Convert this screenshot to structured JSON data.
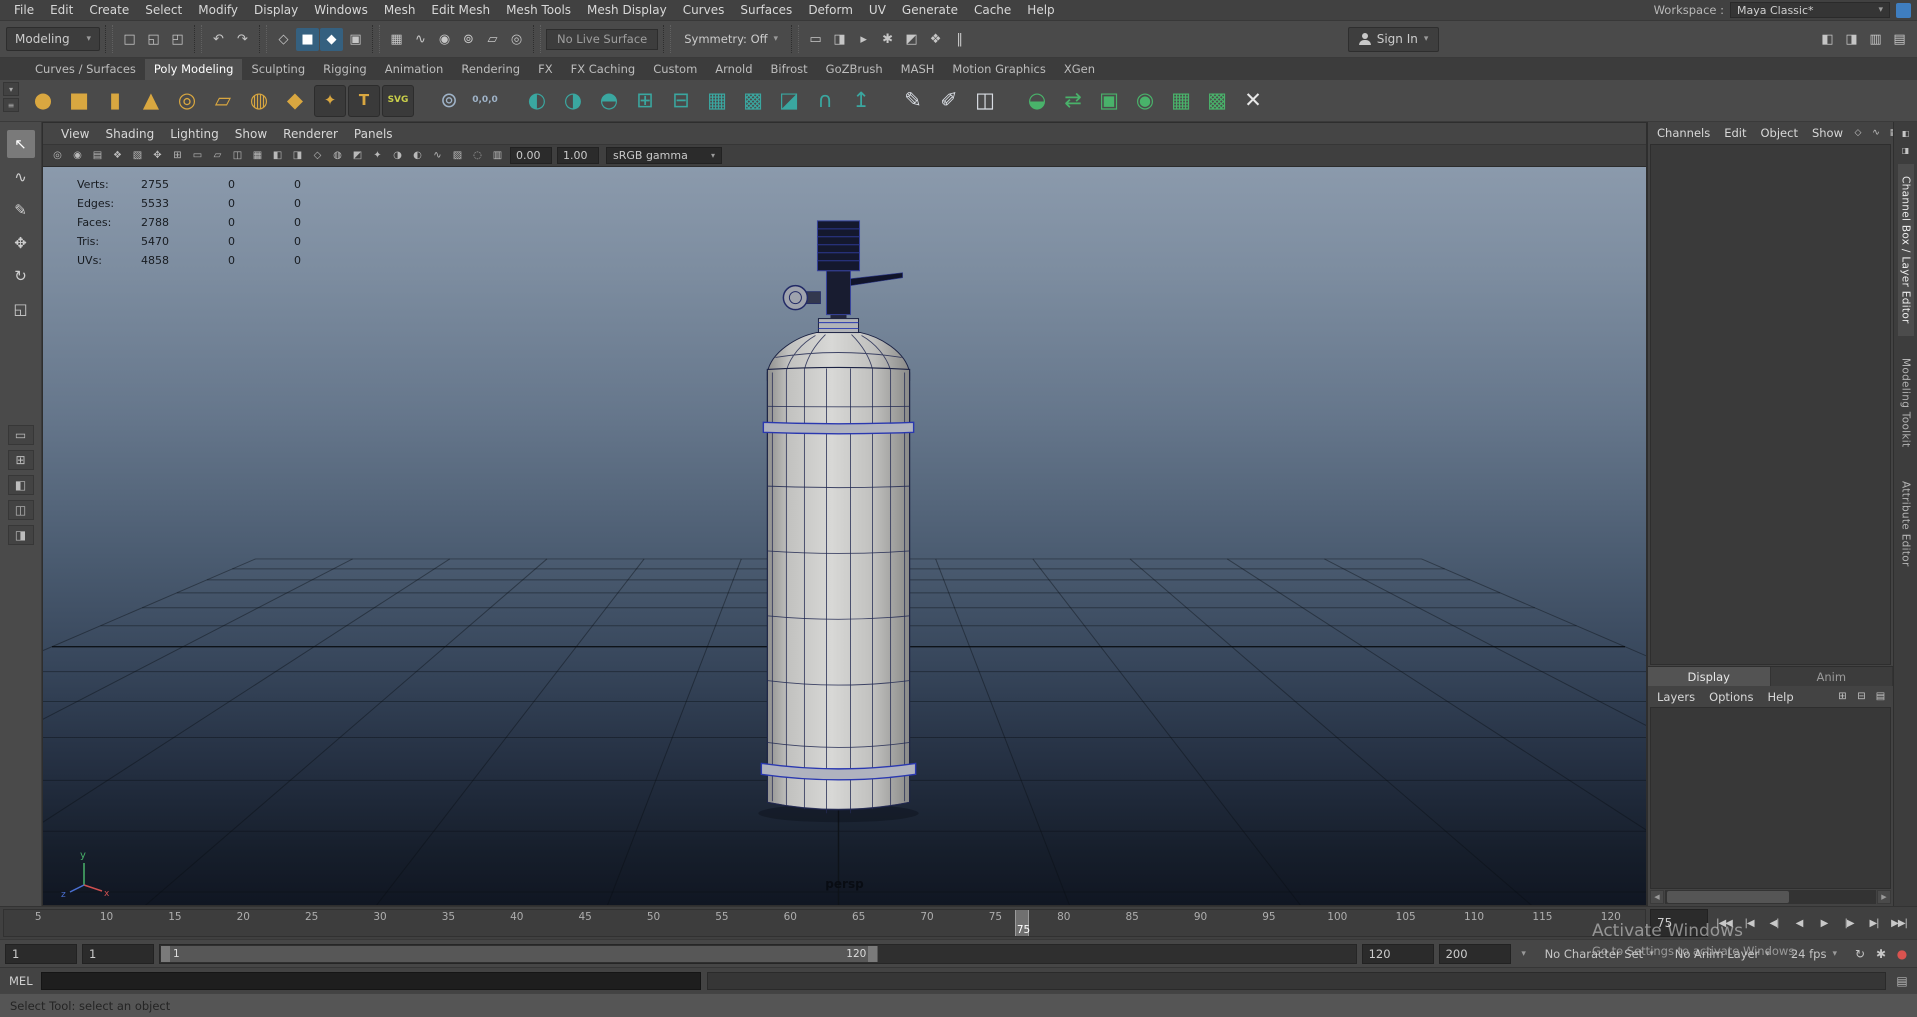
{
  "colors": {
    "accent": "#35607f",
    "workspace_icon_blue": "#3f7ec0",
    "shelf_gold": "#d9a740",
    "shelf_teal": "#3aa7a0",
    "shelf_green": "#49b26a",
    "wireframe_navy": "#232a52",
    "selection_ring_blue": "#2a38b0",
    "autokey_red": "#d9534f"
  },
  "ui": {
    "caret": "▾",
    "shelf_toggle": "▾",
    "shelf_menu": "≡",
    "scroll_left": "◀",
    "scroll_right": "▶"
  },
  "menubar": {
    "items": [
      {
        "name": "menu-file",
        "label": "File"
      },
      {
        "name": "menu-edit",
        "label": "Edit"
      },
      {
        "name": "menu-create",
        "label": "Create"
      },
      {
        "name": "menu-select",
        "label": "Select"
      },
      {
        "name": "menu-modify",
        "label": "Modify"
      },
      {
        "name": "menu-display",
        "label": "Display"
      },
      {
        "name": "menu-windows",
        "label": "Windows"
      },
      {
        "name": "menu-mesh",
        "label": "Mesh"
      },
      {
        "name": "menu-edit-mesh",
        "label": "Edit Mesh"
      },
      {
        "name": "menu-mesh-tools",
        "label": "Mesh Tools"
      },
      {
        "name": "menu-mesh-display",
        "label": "Mesh Display"
      },
      {
        "name": "menu-curves",
        "label": "Curves"
      },
      {
        "name": "menu-surfaces",
        "label": "Surfaces"
      },
      {
        "name": "menu-deform",
        "label": "Deform"
      },
      {
        "name": "menu-uv",
        "label": "UV"
      },
      {
        "name": "menu-generate",
        "label": "Generate"
      },
      {
        "name": "menu-cache",
        "label": "Cache"
      },
      {
        "name": "menu-help",
        "label": "Help"
      }
    ],
    "workspace_label": "Workspace :",
    "workspace_value": "Maya Classic*"
  },
  "statusline": {
    "menuset": "Modeling",
    "file_icons": [
      {
        "name": "new-scene-icon",
        "glyph": "□"
      },
      {
        "name": "open-scene-icon",
        "glyph": "◱"
      },
      {
        "name": "save-scene-icon",
        "glyph": "◰"
      }
    ],
    "history_icons": [
      {
        "name": "undo-icon",
        "glyph": "↶"
      },
      {
        "name": "redo-icon",
        "glyph": "↷"
      }
    ],
    "mask_icons": [
      {
        "name": "select-hierarchy-icon",
        "glyph": "◇"
      },
      {
        "name": "select-object-icon",
        "glyph": "■",
        "active": true
      },
      {
        "name": "select-component-icon",
        "glyph": "◆",
        "active": true
      },
      {
        "name": "selection-mask-icon",
        "glyph": "▣"
      }
    ],
    "snap_icons": [
      {
        "name": "snap-to-grid-icon",
        "glyph": "▦"
      },
      {
        "name": "snap-to-curve-icon",
        "glyph": "∿"
      },
      {
        "name": "snap-to-point-icon",
        "glyph": "◉"
      },
      {
        "name": "snap-to-projected-center-icon",
        "glyph": "⊚"
      },
      {
        "name": "snap-to-view-plane-icon",
        "glyph": "▱"
      },
      {
        "name": "make-live-icon",
        "glyph": "◎"
      }
    ],
    "live_surface": "No Live Surface",
    "symmetry": "Symmetry: Off",
    "render_icons": [
      {
        "name": "render-view-icon",
        "glyph": "▭"
      },
      {
        "name": "render-current-frame-icon",
        "glyph": "◨"
      },
      {
        "name": "ipr-render-icon",
        "glyph": "▸"
      },
      {
        "name": "render-settings-icon",
        "glyph": "✱"
      },
      {
        "name": "hypershade-icon",
        "glyph": "◩"
      },
      {
        "name": "light-editor-icon",
        "glyph": "❖"
      },
      {
        "name": "pause-viewport-icon",
        "glyph": "‖"
      }
    ],
    "signin_label": "Sign In",
    "panel_toggle_icons": [
      {
        "name": "toggle-single-pane-icon",
        "glyph": "◧"
      },
      {
        "name": "toggle-tool-settings-icon",
        "glyph": "◨"
      },
      {
        "name": "toggle-attribute-editor-icon",
        "glyph": "▥"
      },
      {
        "name": "toggle-channel-box-icon",
        "glyph": "▤"
      }
    ]
  },
  "shelf": {
    "tabs": [
      {
        "name": "shelf-tab-curves-surfaces",
        "label": "Curves / Surfaces"
      },
      {
        "name": "shelf-tab-poly-modeling",
        "label": "Poly Modeling",
        "active": true
      },
      {
        "name": "shelf-tab-sculpting",
        "label": "Sculpting"
      },
      {
        "name": "shelf-tab-rigging",
        "label": "Rigging"
      },
      {
        "name": "shelf-tab-animation",
        "label": "Animation"
      },
      {
        "name": "shelf-tab-rendering",
        "label": "Rendering"
      },
      {
        "name": "shelf-tab-fx",
        "label": "FX"
      },
      {
        "name": "shelf-tab-fx-caching",
        "label": "FX Caching"
      },
      {
        "name": "shelf-tab-custom",
        "label": "Custom"
      },
      {
        "name": "shelf-tab-arnold",
        "label": "Arnold"
      },
      {
        "name": "shelf-tab-bifrost",
        "label": "Bifrost"
      },
      {
        "name": "shelf-tab-gozbrush",
        "label": "GoZBrush"
      },
      {
        "name": "shelf-tab-mash",
        "label": "MASH"
      },
      {
        "name": "shelf-tab-motion-graphics",
        "label": "Motion Graphics"
      },
      {
        "name": "shelf-tab-xgen",
        "label": "XGen"
      }
    ],
    "icons": [
      {
        "name": "poly-sphere-icon",
        "glyph": "●",
        "color": "#d9a740"
      },
      {
        "name": "poly-cube-icon",
        "glyph": "■",
        "color": "#d9a740"
      },
      {
        "name": "poly-cylinder-icon",
        "glyph": "▮",
        "color": "#d9a740"
      },
      {
        "name": "poly-cone-icon",
        "glyph": "▲",
        "color": "#d9a740"
      },
      {
        "name": "poly-torus-icon",
        "glyph": "◎",
        "color": "#d9a740"
      },
      {
        "name": "poly-plane-icon",
        "glyph": "▱",
        "color": "#d9a740"
      },
      {
        "name": "poly-disc-icon",
        "glyph": "◍",
        "color": "#d9a740"
      },
      {
        "name": "poly-platonic-icon",
        "glyph": "◆",
        "color": "#d9a740"
      },
      {
        "name": "sweep-mesh-icon",
        "glyph": "✦",
        "color": "#d9a740",
        "cls": "boxed"
      },
      {
        "name": "polygon-type-icon",
        "glyph": "T",
        "color": "#d9a740",
        "cls": "boxed"
      },
      {
        "name": "svg-tool-icon",
        "glyph": "SVG",
        "color": "#c9cf4a",
        "cls": "boxed tiny"
      },
      {
        "cls": "spacer"
      },
      {
        "name": "center-pivot-icon",
        "glyph": "⊚",
        "color": "#9fb3c8"
      },
      {
        "name": "zero-transform-icon",
        "glyph": "0,0,0",
        "color": "#9fb3c8",
        "cls": "tiny"
      },
      {
        "cls": "spacer"
      },
      {
        "name": "boolean-union-icon",
        "glyph": "◐",
        "color": "#3aa7a0"
      },
      {
        "name": "boolean-difference-icon",
        "glyph": "◑",
        "color": "#3aa7a0"
      },
      {
        "name": "boolean-intersection-icon",
        "glyph": "◓",
        "color": "#3aa7a0"
      },
      {
        "name": "combine-icon",
        "glyph": "⊞",
        "color": "#3aa7a0"
      },
      {
        "name": "separate-icon",
        "glyph": "⊟",
        "color": "#3aa7a0"
      },
      {
        "name": "fill-hole-icon",
        "glyph": "▦",
        "color": "#3aa7a0"
      },
      {
        "name": "smooth-icon",
        "glyph": "▩",
        "color": "#3aa7a0"
      },
      {
        "name": "bevel-icon",
        "glyph": "◪",
        "color": "#3aa7a0"
      },
      {
        "name": "bridge-icon",
        "glyph": "∩",
        "color": "#3aa7a0"
      },
      {
        "name": "extrude-icon",
        "glyph": "↥",
        "color": "#3aa7a0"
      },
      {
        "cls": "spacer"
      },
      {
        "name": "multi-cut-icon",
        "glyph": "✎",
        "color": "#d8dce2"
      },
      {
        "name": "quad-draw-icon",
        "glyph": "✐",
        "color": "#d8dce2"
      },
      {
        "name": "insert-edge-loop-icon",
        "glyph": "◫",
        "color": "#d8dce2"
      },
      {
        "cls": "spacer"
      },
      {
        "name": "mirror-icon",
        "glyph": "◒",
        "color": "#49b26a"
      },
      {
        "name": "symmetrize-icon",
        "glyph": "⇄",
        "color": "#49b26a"
      },
      {
        "name": "average-vertices-icon",
        "glyph": "▣",
        "color": "#49b26a"
      },
      {
        "name": "target-weld-icon",
        "glyph": "◉",
        "color": "#49b26a"
      },
      {
        "name": "remesh-icon",
        "glyph": "▦",
        "color": "#49b26a"
      },
      {
        "name": "retopologize-icon",
        "glyph": "▩",
        "color": "#49b26a"
      },
      {
        "name": "delete-history-icon",
        "glyph": "✕",
        "color": "#e8e8e8"
      }
    ]
  },
  "toolbox": {
    "tools": [
      {
        "name": "select-tool",
        "glyph": "↖",
        "active": true
      },
      {
        "name": "lasso-tool",
        "glyph": "∿"
      },
      {
        "name": "paint-selection-tool",
        "glyph": "✎"
      },
      {
        "name": "move-tool",
        "glyph": "✥"
      },
      {
        "name": "rotate-tool",
        "glyph": "↻"
      },
      {
        "name": "scale-tool",
        "glyph": "◱"
      }
    ],
    "layouts": [
      {
        "name": "layout-single-pane-button",
        "glyph": "▭"
      },
      {
        "name": "layout-four-pane-button",
        "glyph": "⊞"
      },
      {
        "name": "layout-persp-outliner-button",
        "glyph": "◧"
      },
      {
        "name": "layout-split-pane-button",
        "glyph": "◫"
      },
      {
        "name": "layout-hypershade-button",
        "glyph": "◨"
      }
    ]
  },
  "viewport": {
    "panel_menu": [
      {
        "name": "panel-menu-view",
        "label": "View"
      },
      {
        "name": "panel-menu-shading",
        "label": "Shading"
      },
      {
        "name": "panel-menu-lighting",
        "label": "Lighting"
      },
      {
        "name": "panel-menu-show",
        "label": "Show"
      },
      {
        "name": "panel-menu-renderer",
        "label": "Renderer"
      },
      {
        "name": "panel-menu-panels",
        "label": "Panels"
      }
    ],
    "toolbar_icons": [
      {
        "name": "select-camera-icon",
        "glyph": "◎"
      },
      {
        "name": "lock-camera-icon",
        "glyph": "◉"
      },
      {
        "name": "camera-attributes-icon",
        "glyph": "▤"
      },
      {
        "name": "bookmark-icon",
        "glyph": "❖"
      },
      {
        "name": "image-plane-icon",
        "glyph": "▧"
      },
      {
        "name": "pan-zoom-icon",
        "glyph": "✥"
      },
      {
        "name": "grid-toggle-icon",
        "glyph": "⊞"
      },
      {
        "name": "film-gate-icon",
        "glyph": "▭"
      },
      {
        "name": "resolution-gate-icon",
        "glyph": "▱"
      },
      {
        "name": "gate-mask-icon",
        "glyph": "◫"
      },
      {
        "name": "field-chart-icon",
        "glyph": "▦"
      },
      {
        "name": "safe-action-icon",
        "glyph": "◧"
      },
      {
        "name": "safe-title-icon",
        "glyph": "◨"
      },
      {
        "name": "wireframe-mode-icon",
        "glyph": "◇"
      },
      {
        "name": "shaded-mode-icon",
        "glyph": "◍"
      },
      {
        "name": "textured-mode-icon",
        "glyph": "◩"
      },
      {
        "name": "lights-icon",
        "glyph": "✦"
      },
      {
        "name": "shadows-icon",
        "glyph": "◑"
      },
      {
        "name": "ambient-occlusion-icon",
        "glyph": "◐"
      },
      {
        "name": "motion-blur-icon",
        "glyph": "∿"
      },
      {
        "name": "multisample-icon",
        "glyph": "▨"
      },
      {
        "name": "isolate-select-icon",
        "glyph": "◌"
      },
      {
        "name": "xray-icon",
        "glyph": "▥"
      }
    ],
    "exposure": "0.00",
    "gamma": "1.00",
    "colorspace": "sRGB gamma",
    "camera_label": "persp",
    "hud_rows": [
      {
        "name": "hud-row-verts",
        "label": "Verts:",
        "total": "2755",
        "a": "0",
        "b": "0"
      },
      {
        "name": "hud-row-edges",
        "label": "Edges:",
        "total": "5533",
        "a": "0",
        "b": "0"
      },
      {
        "name": "hud-row-faces",
        "label": "Faces:",
        "total": "2788",
        "a": "0",
        "b": "0"
      },
      {
        "name": "hud-row-tris",
        "label": "Tris:",
        "total": "5470",
        "a": "0",
        "b": "0"
      },
      {
        "name": "hud-row-uvs",
        "label": "UVs:",
        "total": "4858",
        "a": "0",
        "b": "0"
      }
    ],
    "axis": {
      "x": "x",
      "y": "y",
      "z": "z"
    }
  },
  "right_panel": {
    "menu": [
      {
        "name": "channel-box-menu-channels",
        "label": "Channels"
      },
      {
        "name": "channel-box-menu-edit",
        "label": "Edit"
      },
      {
        "name": "channel-box-menu-object",
        "label": "Object"
      },
      {
        "name": "channel-box-menu-show",
        "label": "Show"
      }
    ],
    "header_icons": [
      {
        "name": "channel-manip-icon",
        "glyph": "◇"
      },
      {
        "name": "channel-speed-icon",
        "glyph": "∿"
      },
      {
        "name": "channel-stats-icon",
        "glyph": "▦"
      }
    ],
    "layer_tabs": [
      {
        "name": "layer-tab-display",
        "label": "Display",
        "active": true
      },
      {
        "name": "layer-tab-anim",
        "label": "Anim"
      }
    ],
    "layer_menu": [
      {
        "name": "layers-menu-layers",
        "label": "Layers"
      },
      {
        "name": "layers-menu-options",
        "label": "Options"
      },
      {
        "name": "layers-menu-help",
        "label": "Help"
      }
    ],
    "layer_icons": [
      {
        "name": "new-empty-layer-icon",
        "glyph": "⊞"
      },
      {
        "name": "new-layer-from-selected-icon",
        "glyph": "⊟"
      },
      {
        "name": "layer-options-icon",
        "glyph": "▤"
      }
    ],
    "vertical_tabs": [
      {
        "name": "vtab-channel-box",
        "label": "Channel Box / Layer Editor",
        "active": true
      },
      {
        "name": "vtab-modeling-toolkit",
        "label": "Modeling Toolkit"
      },
      {
        "name": "vtab-attribute-editor",
        "label": "Attribute Editor"
      }
    ],
    "strip_icons": [
      {
        "name": "sidebar-collapse-icon",
        "glyph": "◧"
      },
      {
        "name": "sidebar-expand-icon",
        "glyph": "◨"
      }
    ]
  },
  "timeline": {
    "ticks": [
      "5",
      "10",
      "15",
      "20",
      "25",
      "30",
      "35",
      "40",
      "45",
      "50",
      "55",
      "60",
      "65",
      "70",
      "75",
      "80",
      "85",
      "90",
      "95",
      "100",
      "105",
      "110",
      "115",
      "120"
    ],
    "current_frame": "75",
    "current_frame_field": "75",
    "playback": [
      {
        "name": "go-to-start-button",
        "glyph": "|◀◀"
      },
      {
        "name": "previous-key-button",
        "glyph": "|◀"
      },
      {
        "name": "step-back-button",
        "glyph": "◀|"
      },
      {
        "name": "play-backwards-button",
        "glyph": "◀"
      },
      {
        "name": "play-button",
        "glyph": "▶"
      },
      {
        "name": "step-forward-button",
        "glyph": "|▶"
      },
      {
        "name": "next-key-button",
        "glyph": "▶|"
      },
      {
        "name": "go-to-end-button",
        "glyph": "▶▶|"
      }
    ]
  },
  "range_slider": {
    "animation_start": "1",
    "playback_start": "1",
    "playback_end": "120",
    "animation_end": "200",
    "handle_start": "1",
    "handle_end": "120",
    "character_set": "No Character Set",
    "anim_layer": "No Anim Layer",
    "fps": "24 fps",
    "icons": [
      {
        "name": "playback-loop-icon",
        "glyph": "↻"
      },
      {
        "name": "anim-preferences-icon",
        "glyph": "✱"
      },
      {
        "name": "auto-key-icon",
        "glyph": "●",
        "color": "#d9534f"
      }
    ]
  },
  "command_line": {
    "label": "MEL"
  },
  "help_line": {
    "text": "Select Tool: select an object"
  },
  "watermark": {
    "line1": "Activate Windows",
    "line2": "Go to Settings to activate Windows."
  }
}
